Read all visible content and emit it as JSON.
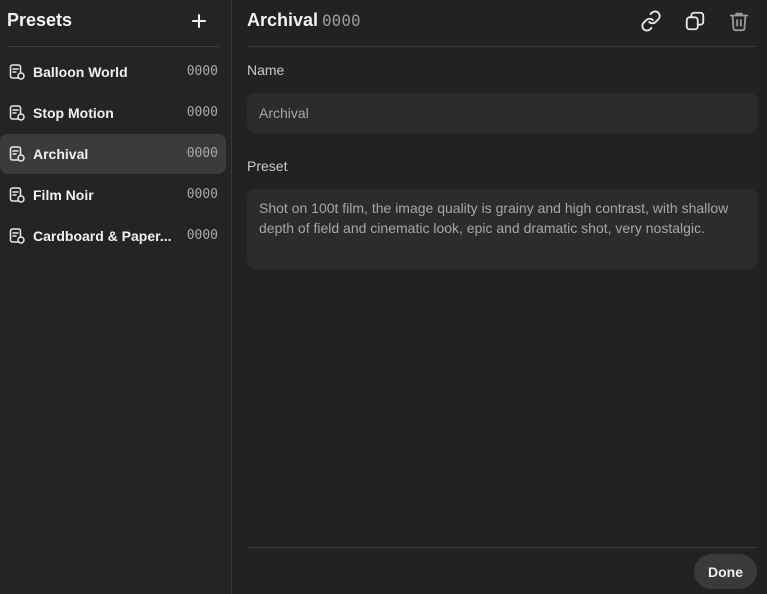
{
  "sidebar": {
    "title": "Presets",
    "add_icon": "plus-icon",
    "items": [
      {
        "label": "Balloon World",
        "code": "0000",
        "icon": "preset-document-icon",
        "active": false
      },
      {
        "label": "Stop Motion",
        "code": "0000",
        "icon": "preset-document-icon",
        "active": false
      },
      {
        "label": "Archival",
        "code": "0000",
        "icon": "preset-document-icon",
        "active": true
      },
      {
        "label": "Film Noir",
        "code": "0000",
        "icon": "preset-document-icon",
        "active": false
      },
      {
        "label": "Cardboard & Paper...",
        "code": "0000",
        "icon": "preset-document-icon",
        "active": false
      }
    ]
  },
  "main": {
    "title": "Archival",
    "code": "0000",
    "actions": [
      "link-icon",
      "copy-icon",
      "trash-icon"
    ],
    "name_label": "Name",
    "name_value": "Archival",
    "preset_label": "Preset",
    "preset_value": "Shot on 100t film, the image quality is grainy and high contrast, with shallow depth of field and cinematic look, epic and dramatic shot, very nostalgic.",
    "done_label": "Done"
  },
  "colors": {
    "background": "#222222",
    "sidebar": "#242424",
    "active_item": "#3b3b3b",
    "field": "#2c2c2c"
  }
}
